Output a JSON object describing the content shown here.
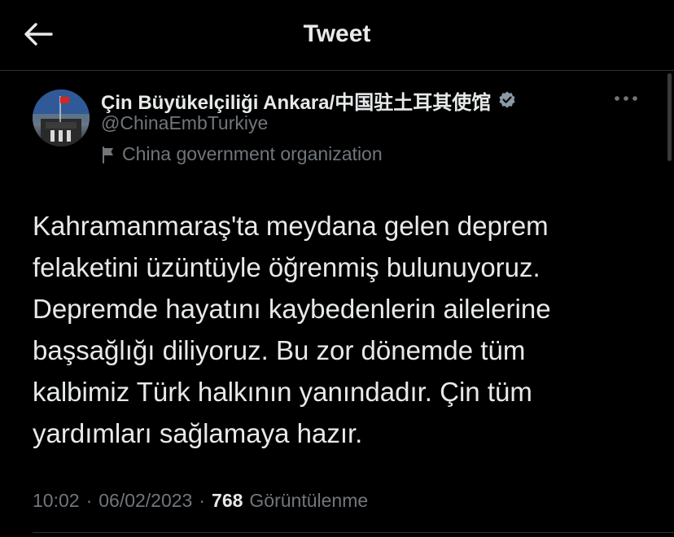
{
  "header": {
    "title": "Tweet",
    "back_icon": "arrow-left-icon"
  },
  "tweet": {
    "author": {
      "display_name": "Çin Büyükelçiliği Ankara/中国驻土耳其使馆",
      "handle": "@ChinaEmbTurkiye",
      "verified_icon": "verified-badge-icon",
      "verified_color": "#8b98a5",
      "label_icon": "flag-icon",
      "label": "China government organization",
      "avatar_icon": "embassy-avatar"
    },
    "more_icon": "more-dots-icon",
    "text": "Kahramanmaraş'ta meydana gelen deprem\nfelaketini üzüntüyle öğrenmiş bulunuyoruz.\nDepremde hayatını kaybedenlerin ailelerine\nbaşsağlığı diliyoruz.  Bu zor dönemde tüm\nkalbimiz Türk halkının yanındadır. Çin tüm\nyardımları sağlamaya hazır.",
    "time": "10:02",
    "date": "06/02/2023",
    "separator": "·",
    "views_count": "768",
    "views_label": "Görüntülenme"
  },
  "colors": {
    "background": "#000000",
    "primary_text": "#e7e9ea",
    "secondary_text": "#71767b",
    "divider": "#2f3336"
  }
}
